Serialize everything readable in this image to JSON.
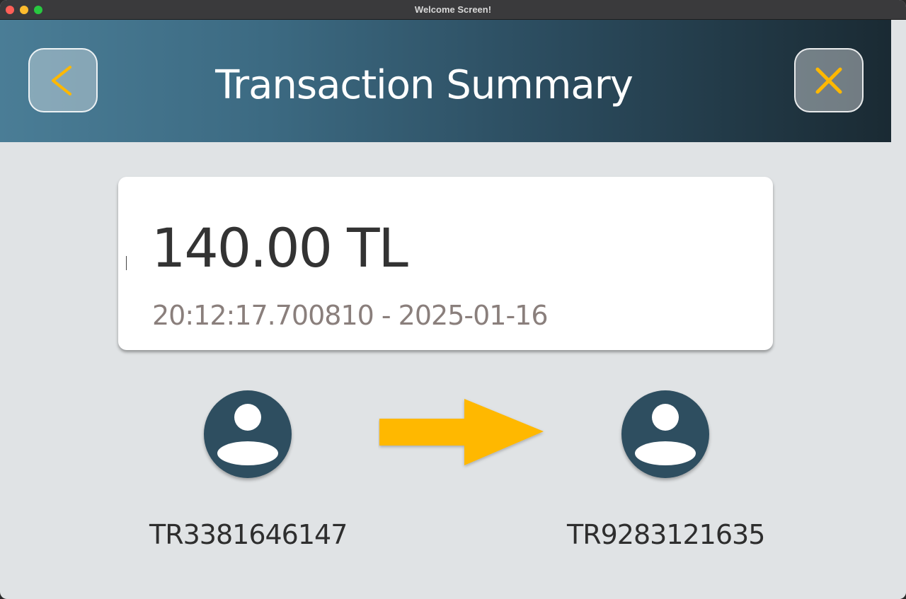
{
  "window": {
    "title": "Welcome Screen!"
  },
  "header": {
    "title": "Transaction Summary",
    "back_icon": "chevron-left-icon",
    "close_icon": "close-icon",
    "accent_color": "#FFB800"
  },
  "transaction": {
    "amount": "140.00 TL",
    "timestamp": "20:12:17.700810 - 2025-01-16"
  },
  "sender": {
    "account": "TR3381646147",
    "icon": "user-avatar-icon"
  },
  "receiver": {
    "account": "TR9283121635",
    "icon": "user-avatar-icon"
  },
  "transfer_icon": "arrow-right-icon",
  "colors": {
    "avatar": "#2E4E60",
    "arrow": "#FFB800",
    "background": "#E0E3E5"
  }
}
